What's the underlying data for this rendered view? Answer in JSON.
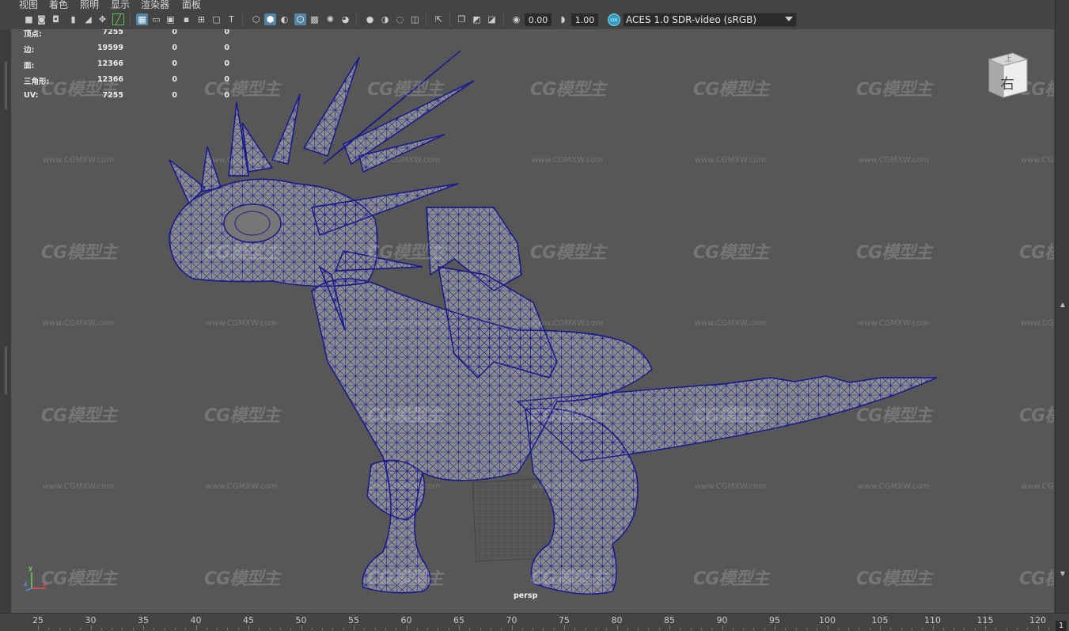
{
  "menu": [
    "视图",
    "着色",
    "照明",
    "显示",
    "渲染器",
    "面板"
  ],
  "toolbar": {
    "exposure_value": "0.00",
    "gamma_value": "1.00",
    "color_space": "ACES 1.0 SDR-video (sRGB)",
    "icons": [
      "camera-select-icon",
      "camera-attributes-icon",
      "bookmark-icon",
      "image-plane-icon",
      "grease-pencil-icon",
      "2d-pan-zoom-icon",
      "grid-icon",
      "film-gate-icon",
      "resolution-gate-icon",
      "gate-mask-icon",
      "field-chart-icon",
      "safe-action-icon",
      "safe-title-icon",
      "wireframe-icon",
      "smooth-shade-icon",
      "use-default-material-icon",
      "wireframe-on-shaded-icon",
      "textured-icon",
      "lighting-icon",
      "shadows-icon",
      "ambient-occlusion-icon",
      "motion-blur-icon",
      "anti-aliasing-icon",
      "depth-of-field-icon",
      "isolate-select-icon",
      "xray-icon",
      "xray-joints-icon",
      "xray-components-icon",
      "exposure-icon",
      "gamma-icon",
      "color-management-icon"
    ]
  },
  "hud": {
    "rows": [
      {
        "label": "顶点:",
        "v1": "7255",
        "v2": "0",
        "v3": "0"
      },
      {
        "label": "边:",
        "v1": "19599",
        "v2": "0",
        "v3": "0"
      },
      {
        "label": "面:",
        "v1": "12366",
        "v2": "0",
        "v3": "0"
      },
      {
        "label": "三角形:",
        "v1": "12366",
        "v2": "0",
        "v3": "0"
      },
      {
        "label": "UV:",
        "v1": "7255",
        "v2": "0",
        "v3": "0"
      }
    ]
  },
  "viewport": {
    "camera_label": "persp",
    "viewcube_face": "右",
    "viewcube_top": "上",
    "mesh_color": "#1a1a8c",
    "mesh_fill": "#8c8c8c",
    "background": "#575757"
  },
  "axis": {
    "x": "x",
    "y": "y",
    "z": "z"
  },
  "watermark": {
    "logo": "CG模型主",
    "url": "www.CGMXW.com"
  },
  "timeline": {
    "ticks": [
      "25",
      "30",
      "35",
      "40",
      "45",
      "50",
      "55",
      "60",
      "65",
      "70",
      "75",
      "80",
      "85",
      "90",
      "95",
      "100",
      "105",
      "110",
      "115",
      "120"
    ],
    "current_frame": "1"
  }
}
